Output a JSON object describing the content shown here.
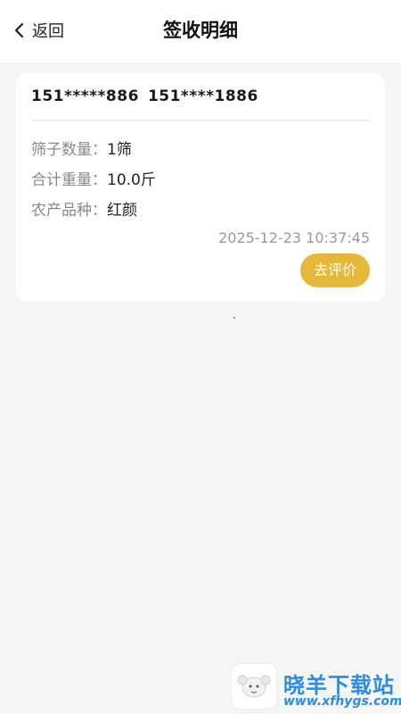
{
  "header": {
    "back_label": "返回",
    "title": "签收明细"
  },
  "record": {
    "phone_1": "151*****886",
    "phone_2": "151****1886",
    "fields": [
      {
        "label": "筛子数量：",
        "value": "1筛"
      },
      {
        "label": "合计重量：",
        "value": "10.0斤"
      },
      {
        "label": "农产品种：",
        "value": "红颜"
      }
    ],
    "timestamp": "2025-12-23 10:37:45",
    "review_label": "去评价"
  },
  "watermark": {
    "name": "晓羊下载站",
    "url": "www.xfhygs.com"
  },
  "colors": {
    "accent": "#e6b83a",
    "background": "#f5f5f5",
    "watermark": "#2b8de0"
  },
  "icons": {
    "back": "chevron-left-icon",
    "logo": "sheep-logo-icon"
  }
}
